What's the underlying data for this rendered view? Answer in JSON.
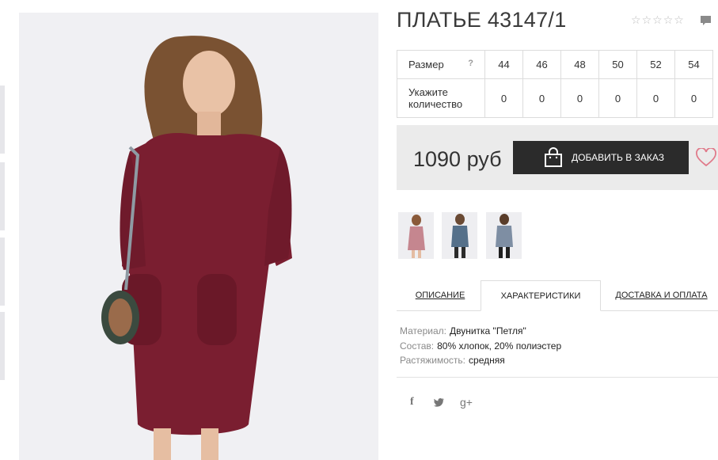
{
  "product": {
    "title": "ПЛАТЬЕ 43147/1",
    "rating_stars": 5,
    "rating_value": 0
  },
  "sizes": {
    "size_label": "Размер",
    "help": "?",
    "qty_label": "Укажите количество",
    "values": [
      "44",
      "46",
      "48",
      "50",
      "52",
      "54"
    ],
    "quantities": [
      "0",
      "0",
      "0",
      "0",
      "0",
      "0"
    ]
  },
  "purchase": {
    "price": "1090 руб",
    "add_label": "ДОБАВИТЬ В ЗАКАЗ"
  },
  "tabs": {
    "description": "ОПИСАНИЕ",
    "specs": "ХАРАКТЕРИСТИКИ",
    "delivery": "ДОСТАВКА И ОПЛАТА"
  },
  "specs": [
    {
      "key": "Материал:",
      "value": "Двунитка \"Петля\""
    },
    {
      "key": "Состав:",
      "value": "80% хлопок, 20% полиэстер"
    },
    {
      "key": "Растяжимость:",
      "value": "средняя"
    }
  ],
  "social": {
    "facebook": "f",
    "gplus": "g+"
  },
  "colors": {
    "dress": "#7a1e30",
    "button": "#2b2b2b",
    "heart": "#e07a8a"
  },
  "icons": [
    "star-icon",
    "comment-icon",
    "shopping-bag-icon",
    "heart-icon",
    "facebook-icon",
    "twitter-icon",
    "google-plus-icon"
  ]
}
